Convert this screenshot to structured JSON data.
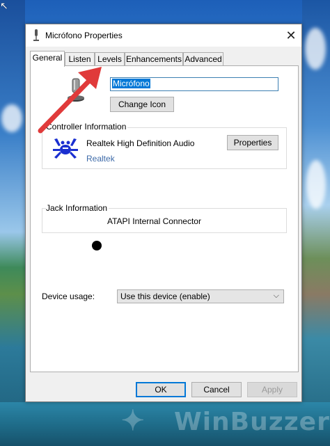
{
  "window": {
    "title": "Micrófono Properties",
    "close_glyph": "✕"
  },
  "tabs": [
    {
      "label": "General",
      "active": true
    },
    {
      "label": "Listen",
      "active": false
    },
    {
      "label": "Levels",
      "active": false
    },
    {
      "label": "Enhancements",
      "active": false
    },
    {
      "label": "Advanced",
      "active": false
    }
  ],
  "general": {
    "device_name_value": "Micrófono",
    "change_icon_label": "Change Icon",
    "controller": {
      "group_label": "Controller Information",
      "name": "Realtek High Definition Audio",
      "vendor_link": "Realtek",
      "properties_label": "Properties"
    },
    "jack": {
      "group_label": "Jack Information",
      "connector": "ATAPI Internal Connector"
    },
    "device_usage": {
      "label": "Device usage:",
      "selected": "Use this device (enable)"
    }
  },
  "footer": {
    "ok_label": "OK",
    "cancel_label": "Cancel",
    "apply_label": "Apply"
  },
  "overlay": {
    "watermark_text": "WinBuzzer",
    "arrow_color": "#e03a3a",
    "arrow_target": "Levels tab"
  },
  "colors": {
    "accent": "#0078d7",
    "link": "#3d6aa8",
    "realtek_blue": "#1a2fd0"
  },
  "icons": {
    "title": "microphone-icon",
    "close": "close-icon",
    "device": "microphone-icon",
    "controller": "realtek-crab-icon",
    "jack": "jack-dot-icon",
    "dropdown": "chevron-down-icon"
  }
}
